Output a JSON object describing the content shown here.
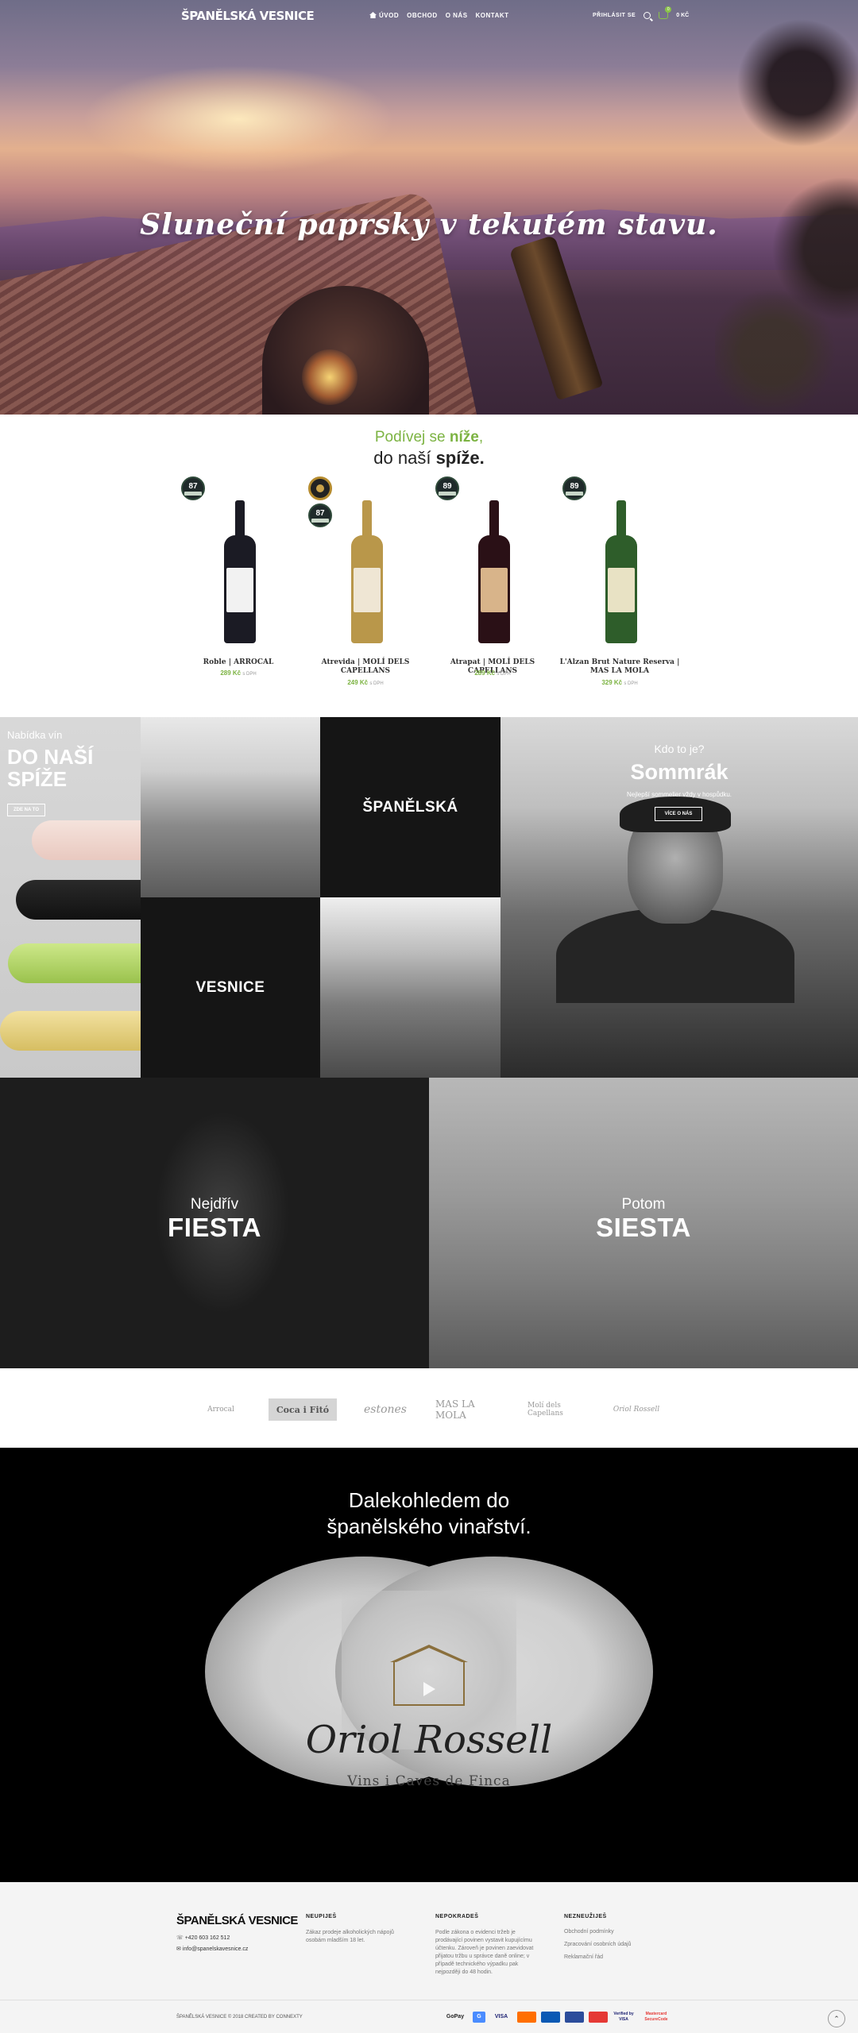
{
  "header": {
    "logo": "ŠPANĚLSKÁ VESNICE",
    "menu": [
      {
        "label": "ÚVOD",
        "icon": "home-icon"
      },
      {
        "label": "OBCHOD"
      },
      {
        "label": "O NÁS"
      },
      {
        "label": "KONTAKT"
      }
    ],
    "login": "PŘIHLÁSIT SE",
    "cart_count": "0",
    "cart_total": "0 KČ"
  },
  "hero": {
    "title": "Sluneční paprsky v tekutém stavu."
  },
  "intro": {
    "line1_prefix": "Podívej se ",
    "line1_bold": "níže",
    "line1_suffix": ",",
    "line2_prefix": "do naší ",
    "line2_bold": "spíže."
  },
  "products": [
    {
      "name": "Roble | ARROCAL",
      "price": "289 Kč",
      "vat": "s DPH",
      "rating": "87",
      "medal": false,
      "colors": {
        "glass": "#1b1b24",
        "label": "#f2f2f2"
      }
    },
    {
      "name": "Atrevida | MOLÍ DELS CAPELLANS",
      "price": "249 Kč",
      "vat": "s DPH",
      "rating": "87",
      "medal": true,
      "colors": {
        "glass": "#b9974a",
        "label": "#efe6d4"
      }
    },
    {
      "name": "Atrapat | MOLÍ DELS CAPELLANS",
      "price": "289 Kč",
      "vat": "s DPH",
      "rating": "89",
      "medal": false,
      "colors": {
        "glass": "#2a1016",
        "label": "#d8b48a"
      }
    },
    {
      "name": "L'Alzan Brut Nature Reserva | MAS LA MOLA",
      "price": "329 Kč",
      "vat": "s DPH",
      "rating": "89",
      "medal": false,
      "colors": {
        "glass": "#2e5d2a",
        "label": "#e8e2c4"
      }
    }
  ],
  "tiles": {
    "offer": {
      "kicker": "Nabídka vín",
      "big1": "DO NAŠÍ",
      "big2": "SPÍŽE",
      "cta": "ZDE NA TO"
    },
    "spanelska": "ŠPANĚLSKÁ",
    "vesnice": "VESNICE",
    "sommrak": {
      "kicker": "Kdo to je?",
      "big": "Sommrák",
      "sub": "Nejlepší sommelier vždy v hospůdku.",
      "cta": "VÍCE O NÁS"
    },
    "fiesta": {
      "kicker": "Nejdřív",
      "big": "FIESTA"
    },
    "siesta": {
      "kicker": "Potom",
      "big": "SIESTA"
    }
  },
  "partners": [
    "Arrocal",
    "Coca i Fitó",
    "estones",
    "MAS LA MOLA",
    "Molí dels Capellans",
    "Oriol Rossell"
  ],
  "binocular": {
    "line1": "Dalekohledem do",
    "line2": "španělského vinařství.",
    "brand": "Oriol Rossell",
    "brand_sub": "Vins i Caves de Finca"
  },
  "footer": {
    "logo": "ŠPANĚLSKÁ VESNICE",
    "phone": "+420 603 162 512",
    "email": "info@spanelskavesnice.cz",
    "col1": {
      "title": "NEUPIJEŠ",
      "text": "Zákaz prodeje alkoholických nápojů osobám mladším 18 let."
    },
    "col2": {
      "title": "NEPOKRADEŠ",
      "text": "Podle zákona o evidenci tržeb je prodávající povinen vystavit kupujícímu účtenku. Zároveň je povinen zaevidovat přijatou tržbu u správce daně online; v případě technického výpadku pak nejpozději do 48 hodin."
    },
    "col3": {
      "title": "NEZNEUŽIJEŠ",
      "links": [
        "Obchodní podmínky",
        "Zpracování osobních údajů",
        "Reklamační řád"
      ]
    },
    "copyright": "ŠPANĚLSKÁ VESNICE © 2018 CREATED BY CONNEXTY",
    "payments": [
      "GoPay",
      "G",
      "VISA",
      "MC",
      "Maestro",
      "",
      "Mastercard",
      "Verified by VISA",
      "Mastercard SecureCode"
    ]
  },
  "colors": {
    "accent": "#7cb342",
    "dark_tile": "#151515"
  }
}
